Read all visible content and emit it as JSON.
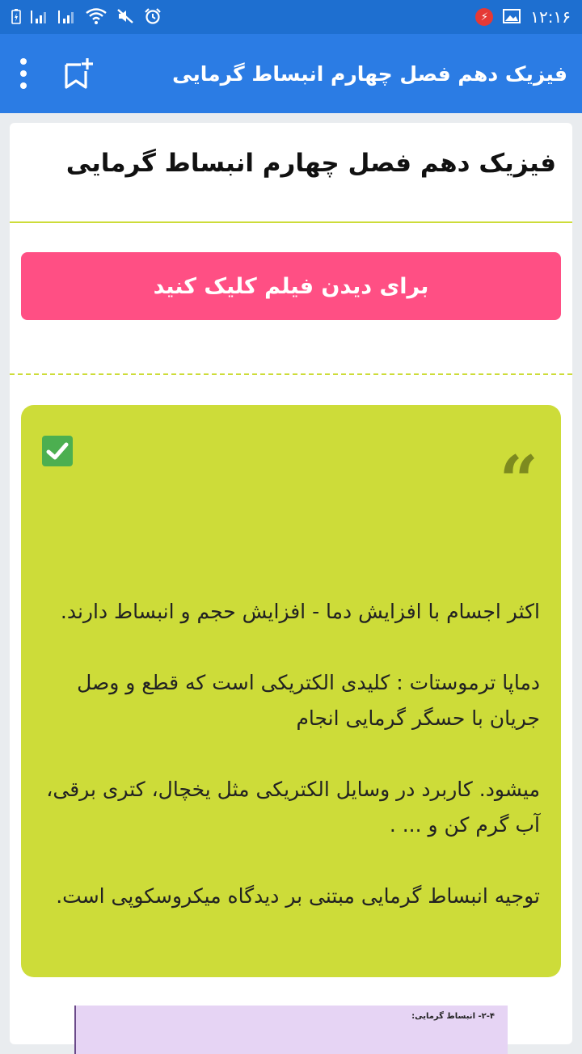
{
  "status_bar": {
    "time": "۱۲:۱۶",
    "icons": [
      "image-icon",
      "alert-icon",
      "alarm-icon",
      "mute-icon",
      "wifi-icon",
      "signal-icon",
      "signal-icon",
      "battery-icon"
    ]
  },
  "app_bar": {
    "title": "فیزیک دهم فصل چهارم انبساط گرمایی",
    "actions": [
      "bookmark-add-icon",
      "more-options-icon"
    ]
  },
  "post": {
    "title": "فیزیک دهم فصل چهارم انبساط گرمایی",
    "film_button_label": "برای دیدن فیلم کلیک کنید",
    "quote_mark": "“",
    "paragraphs": [
      "اکثر اجسام با افزایش دما - افزایش حجم و انبساط دارند.",
      "دماپا  ترموستات : کلیدی الکتریکی است که قطع و وصل جریان با حسگر گرمایی انجام",
      "میشود. کاربرد در وسایل الکتریکی مثل یخچال، کتری برقی، آب گرم کن و ... .",
      "توجیه انبساط گرمایی مبتنی بر دیدگاه میکروسکوپی است."
    ],
    "image_caption": "۲-۴- انبساط گرمایی:"
  },
  "colors": {
    "status_bar": "#1e6fd0",
    "app_bar": "#2b7ce4",
    "accent_lime": "#cddc39",
    "button_pink": "#ff4f84"
  }
}
